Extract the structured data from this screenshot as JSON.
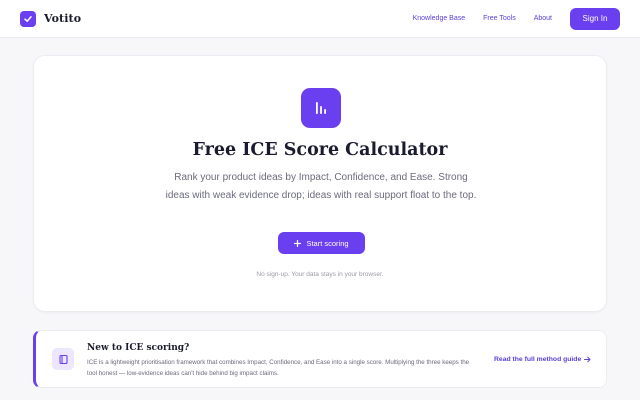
{
  "header": {
    "brand": "Votito",
    "nav": [
      "Knowledge Base",
      "Free Tools",
      "About"
    ],
    "signin_label": "Sign In"
  },
  "hero": {
    "title": "Free ICE Score Calculator",
    "description": "Rank your product ideas by Impact, Confidence, and Ease. Strong ideas with weak evidence drop; ideas with real support float to the top.",
    "start_label": "Start scoring",
    "note": "No sign-up. Your data stays in your browser."
  },
  "info": {
    "title": "New to ICE scoring?",
    "text": "ICE is a lightweight prioritisation framework that combines Impact, Confidence, and Ease into a single score. Multiplying the three keeps the tool honest — low-evidence ideas can't hide behind big impact claims.",
    "link": "Read the full method guide"
  },
  "icons": {
    "brand": "check-icon",
    "hero": "bar-chart-icon",
    "start": "plus-icon",
    "info": "book-icon",
    "link": "arrow-right-icon"
  },
  "colors": {
    "accent": "#6a3ff0",
    "link": "#5b3fd8",
    "background": "#f7f7fa"
  }
}
